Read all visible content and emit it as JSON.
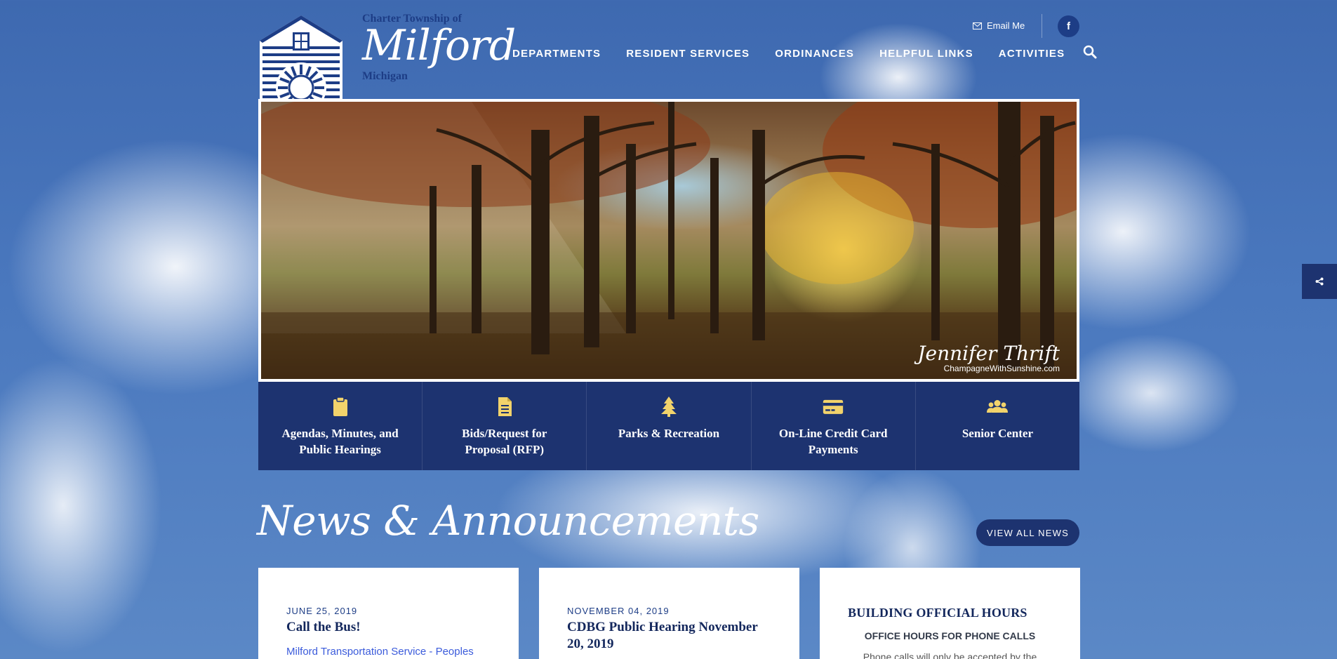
{
  "brand": {
    "top_line": "Charter Township of",
    "name": "Milford",
    "bottom_line": "Michigan"
  },
  "utility": {
    "email_label": "Email Me",
    "facebook_label": "f"
  },
  "nav": {
    "items": [
      {
        "label": "DEPARTMENTS"
      },
      {
        "label": "RESIDENT SERVICES"
      },
      {
        "label": "ORDINANCES"
      },
      {
        "label": "HELPFUL LINKS"
      },
      {
        "label": "ACTIVITIES"
      }
    ]
  },
  "hero": {
    "credit_signature": "Jennifer Thrift",
    "credit_site": "ChampagneWithSunshine.com"
  },
  "quick_links": [
    {
      "label": "Agendas, Minutes, and Public Hearings",
      "icon": "clipboard-icon"
    },
    {
      "label": "Bids/Request for Proposal (RFP)",
      "icon": "document-icon"
    },
    {
      "label": "Parks & Recreation",
      "icon": "tree-icon"
    },
    {
      "label": "On-Line Credit Card Payments",
      "icon": "credit-card-icon"
    },
    {
      "label": "Senior Center",
      "icon": "users-icon"
    }
  ],
  "news": {
    "heading": "News & Announcements",
    "view_all_label": "VIEW ALL NEWS",
    "cards": [
      {
        "date": "JUNE 25, 2019",
        "title": "Call the Bus!",
        "excerpt": "Milford Transportation Service - Peoples"
      },
      {
        "date": "NOVEMBER 04, 2019",
        "title": "CDBG Public Hearing November 20, 2019",
        "excerpt": ""
      }
    ],
    "hours_card": {
      "title": "BUILDING OFFICIAL HOURS",
      "subtitle": "OFFICE HOURS FOR PHONE CALLS",
      "text": "Phone calls will only be accepted by the"
    }
  },
  "colors": {
    "navy": "#1d3370",
    "brand_blue": "#1d3d86",
    "icon_gold": "#f2d36b"
  }
}
